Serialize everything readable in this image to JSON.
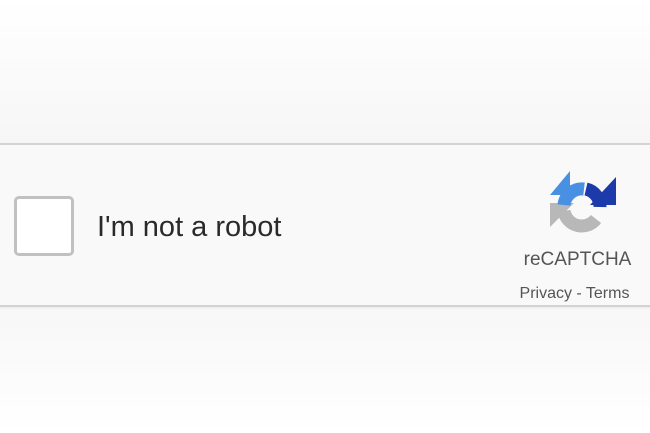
{
  "captcha": {
    "checkbox_checked": false,
    "label": "I'm not a robot",
    "brand": "reCAPTCHA",
    "privacy_label": "Privacy",
    "separator": " - ",
    "terms_label": "Terms",
    "logo_icon": "recaptcha-logo-icon",
    "colors": {
      "logo_blue_dark": "#1c3aa9",
      "logo_blue": "#4a90e2",
      "logo_gray": "#b8b8b8",
      "checkbox_border": "#c1c1c1",
      "border": "#d3d3d3",
      "text": "#2a2a2a",
      "muted_text": "#555555"
    }
  }
}
